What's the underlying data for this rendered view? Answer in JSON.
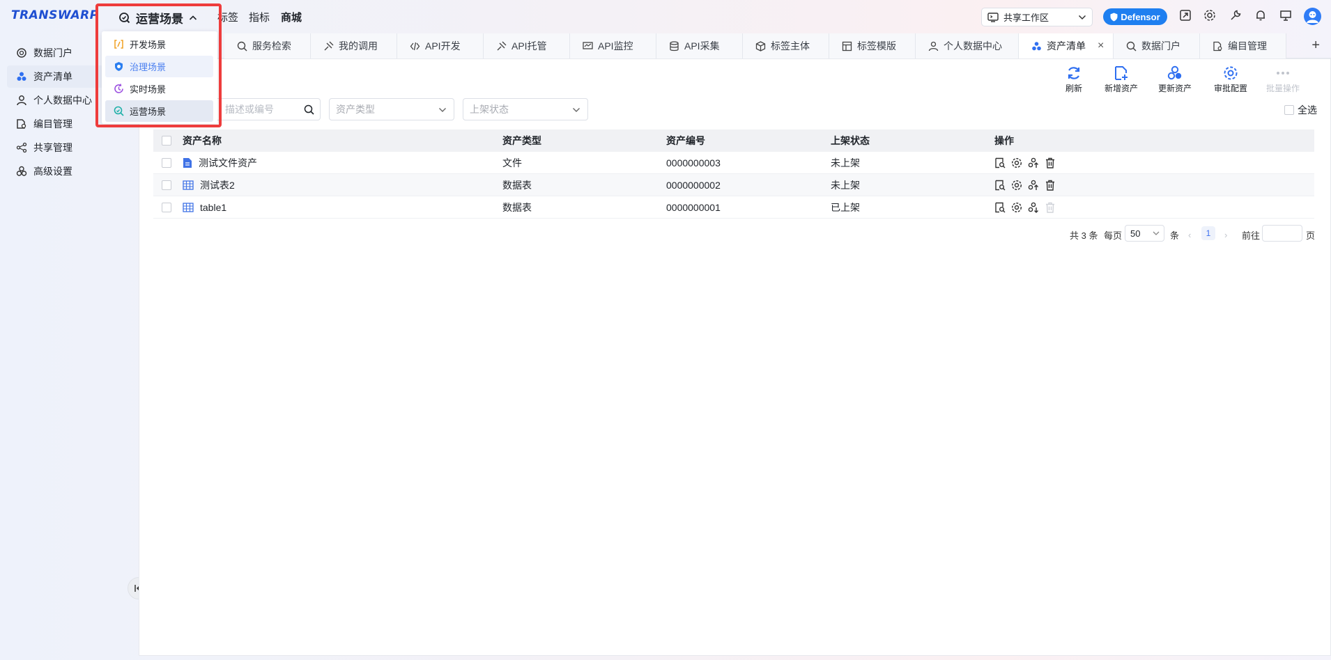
{
  "header": {
    "logo": "TRANSWARP",
    "scene_label": "运营场景",
    "nav": [
      {
        "label": "标签"
      },
      {
        "label": "指标"
      },
      {
        "label": "商城"
      }
    ],
    "workspace": "共享工作区",
    "defensor": "Defensor"
  },
  "scene_dropdown": {
    "items": [
      {
        "label": "开发场景",
        "icon": "code-bracket-icon",
        "color": "#f0a020"
      },
      {
        "label": "治理场景",
        "icon": "shield-icon",
        "color": "#2a7ef0"
      },
      {
        "label": "实时场景",
        "icon": "realtime-icon",
        "color": "#9b4fe0"
      },
      {
        "label": "运营场景",
        "icon": "operation-search-icon",
        "color": "#1fb0a8"
      }
    ],
    "selected": "运营场景"
  },
  "sidebar": {
    "items": [
      {
        "label": "数据门户",
        "icon": "portal-icon"
      },
      {
        "label": "资产清单",
        "icon": "asset-icon",
        "active": true
      },
      {
        "label": "个人数据中心",
        "icon": "person-icon"
      },
      {
        "label": "编目管理",
        "icon": "catalog-icon"
      },
      {
        "label": "共享管理",
        "icon": "share-icon"
      },
      {
        "label": "高级设置",
        "icon": "settings-cluster-icon"
      }
    ]
  },
  "tabs": [
    {
      "label": "服务检索",
      "icon": "search-service-icon"
    },
    {
      "label": "我的调用",
      "icon": "call-icon"
    },
    {
      "label": "API开发",
      "icon": "code-icon"
    },
    {
      "label": "API托管",
      "icon": "hosting-icon"
    },
    {
      "label": "API监控",
      "icon": "monitor-icon"
    },
    {
      "label": "API采集",
      "icon": "database-icon"
    },
    {
      "label": "标签主体",
      "icon": "cube-icon"
    },
    {
      "label": "标签模版",
      "icon": "template-icon"
    },
    {
      "label": "个人数据中心",
      "icon": "person-icon"
    },
    {
      "label": "资产清单",
      "icon": "asset-icon",
      "active": true
    },
    {
      "label": "数据门户",
      "icon": "portal-icon"
    },
    {
      "label": "编目管理",
      "icon": "catalog-icon"
    }
  ],
  "toolbar": {
    "refresh": "刷新",
    "add": "新增资产",
    "update": "更新资产",
    "approval": "审批配置",
    "batch": "批量操作"
  },
  "filters": {
    "search_placeholder": "描述或编号",
    "type_placeholder": "资产类型",
    "status_placeholder": "上架状态",
    "select_all": "全选"
  },
  "table": {
    "columns": [
      "资产名称",
      "资产类型",
      "资产编号",
      "上架状态",
      "操作"
    ],
    "rows": [
      {
        "name": "测试文件资产",
        "type": "文件",
        "code": "0000000003",
        "status": "未上架",
        "icon": "file-icon"
      },
      {
        "name": "测试表2",
        "type": "数据表",
        "code": "0000000002",
        "status": "未上架",
        "icon": "table-icon"
      },
      {
        "name": "table1",
        "type": "数据表",
        "code": "0000000001",
        "status": "已上架",
        "icon": "table-icon"
      }
    ]
  },
  "pagination": {
    "total": "共 3 条",
    "per_page_label": "每页",
    "page_size": "50",
    "unit": "条",
    "current_page": "1",
    "goto_label": "前往",
    "page_suffix": "页"
  },
  "colors": {
    "brand": "#1f4fd1",
    "accent": "#2f6ff0",
    "highlight": "#ee3c3c"
  }
}
